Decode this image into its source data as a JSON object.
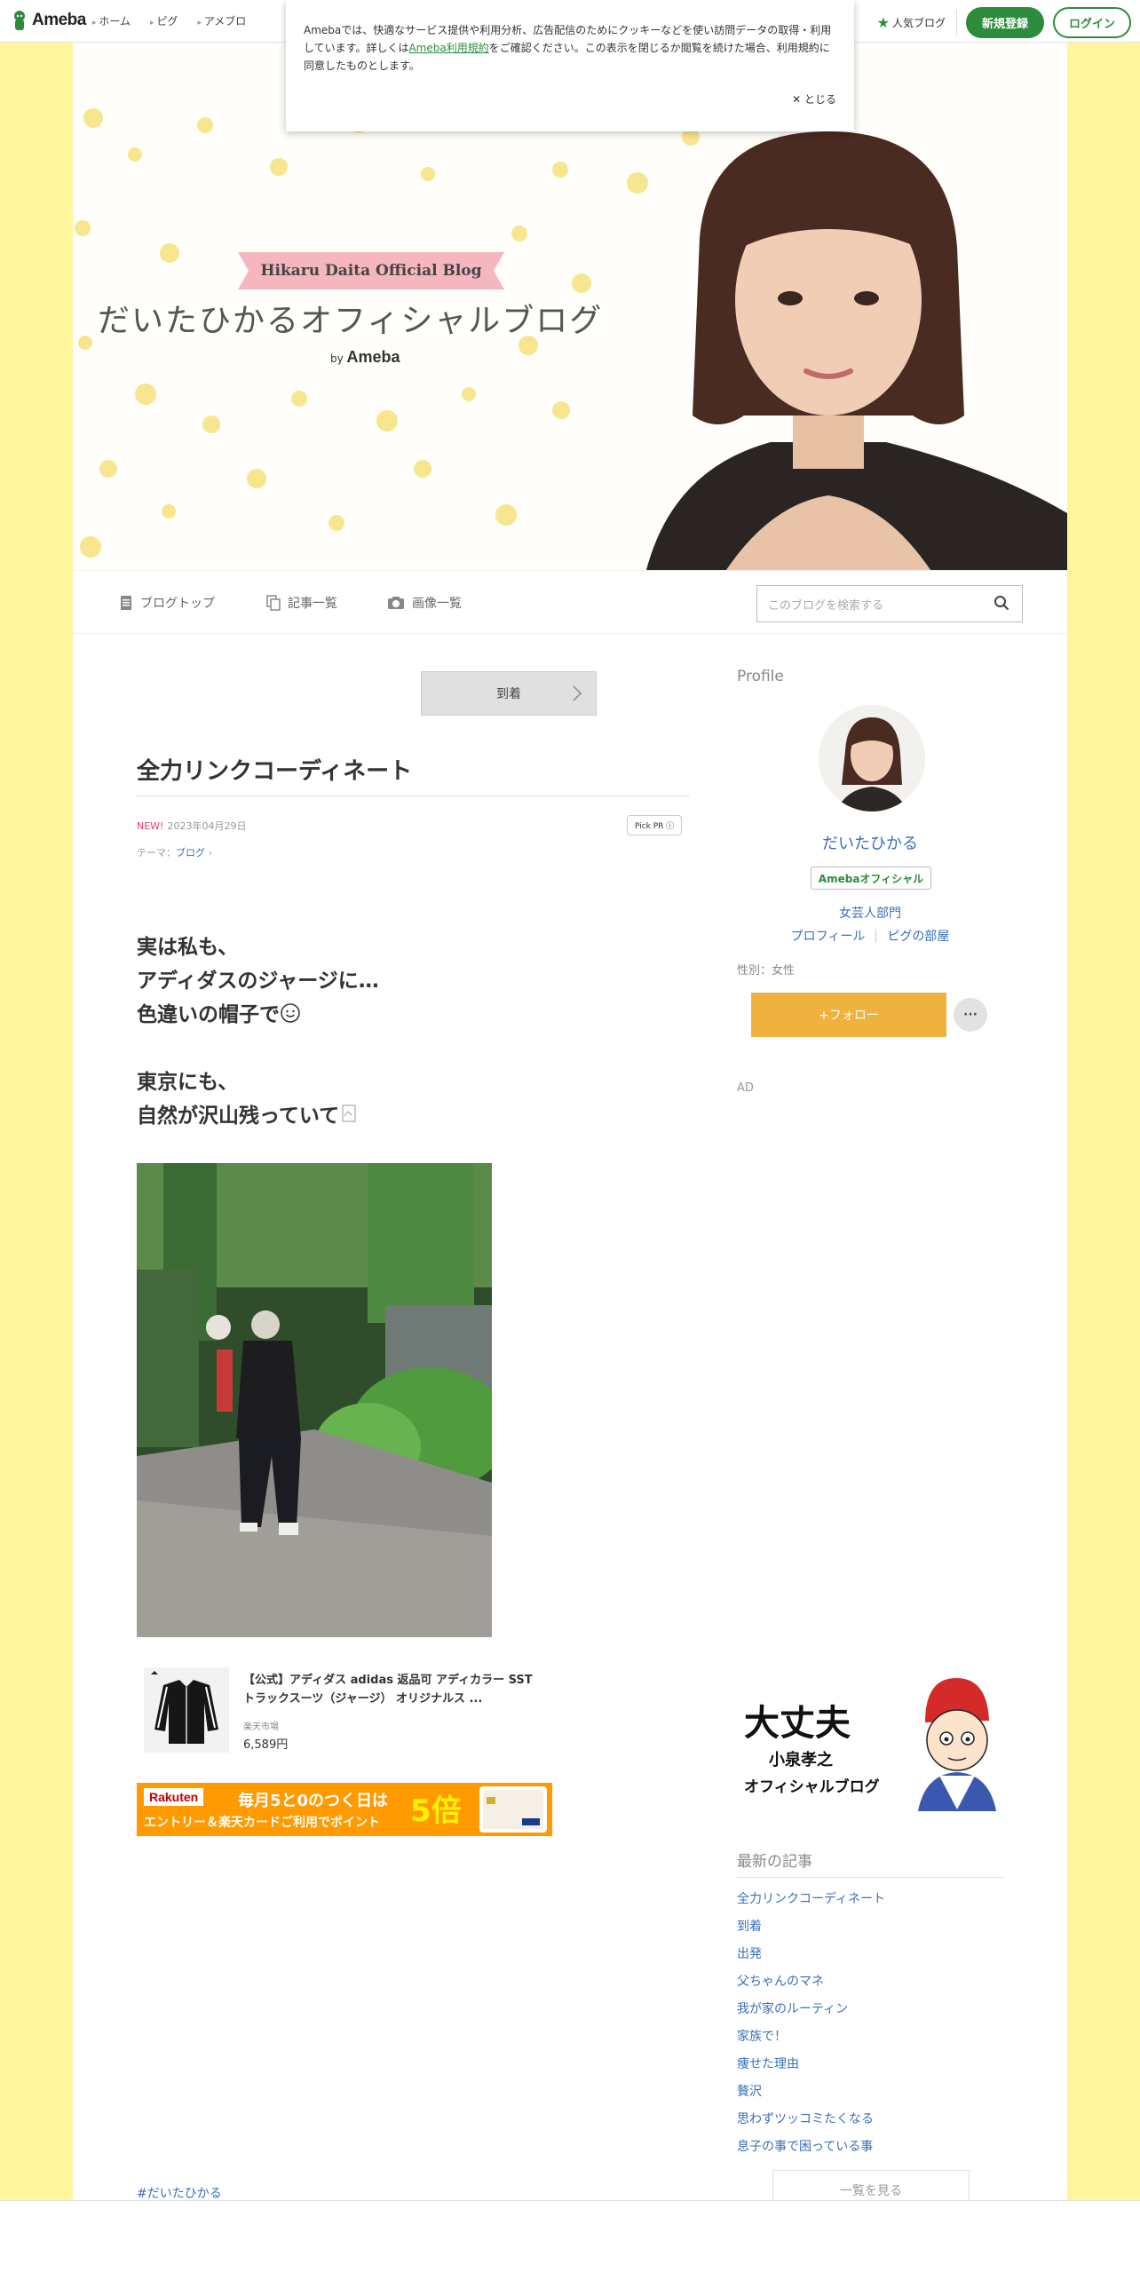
{
  "header": {
    "logo": "Ameba",
    "nav": [
      "ホーム",
      "ピグ",
      "アメブロ"
    ],
    "popular_blog": "人気ブログ",
    "signup": "新規登録",
    "login": "ログイン"
  },
  "cookie": {
    "text_before": "Amebaでは、快適なサービス提供や利用分析、広告配信のためにクッキーなどを使い訪問データの取得・利用しています。詳しくは",
    "link": "Ameba利用規約",
    "text_after": "をご確認ください。この表示を閉じるか閲覧を続けた場合、利用規約に同意したものとします。",
    "close": "とじる"
  },
  "banner": {
    "ribbon": "Hikaru Daita Official Blog",
    "title": "だいたひかるオフィシャルブログ",
    "by": "by",
    "brand": "Ameba"
  },
  "subnav": {
    "top": "ブログトップ",
    "list": "記事一覧",
    "images": "画像一覧",
    "search_placeholder": "このブログを検索する"
  },
  "article": {
    "next_label": "到着",
    "title": "全力リンクコーディネート",
    "new": "NEW!",
    "date": "2023年04月29日",
    "pickpr": "Pick PR ⓘ",
    "theme_label": "テーマ：",
    "theme": "ブログ",
    "lines1": [
      "実は私も、",
      "アディダスのジャージに…",
      "色違いの帽子で"
    ],
    "lines2": [
      "東京にも、",
      "自然が沢山残っていて"
    ],
    "product_title": "【公式】アディダス adidas 返品可 アディカラー SST トラックスーツ（ジャージ） オリジナルス ...",
    "product_shop": "楽天市場",
    "product_price": "6,589円",
    "rakuten_brand": "Rakuten",
    "rakuten_line1": "毎月5と0のつく日は",
    "rakuten_line2": "エントリー＆楽天カードご利用でポイント",
    "rakuten_big": "5倍",
    "hashtag": "#だいたひかる"
  },
  "sidebar": {
    "profile_heading": "Profile",
    "name": "だいたひかる",
    "official": "Amebaオフィシャル",
    "category": "女芸人部門",
    "link_profile": "プロフィール",
    "link_pig": "ピグの部屋",
    "gender": "性別：女性",
    "follow": "+フォロー",
    "more": "···",
    "ad": "AD",
    "ad_line1": "大丈夫",
    "ad_line2": "小泉孝之",
    "ad_line3": "オフィシャルブログ",
    "recent_heading": "最新の記事",
    "recent": [
      "全力リンクコーディネート",
      "到着",
      "出発",
      "父ちゃんのマネ",
      "我が家のルーティン",
      "家族で！",
      "痩せた理由",
      "贅沢",
      "思わずツッコミたくなる",
      "息子の事で困っている事"
    ],
    "see_all": "一覧を見る"
  }
}
